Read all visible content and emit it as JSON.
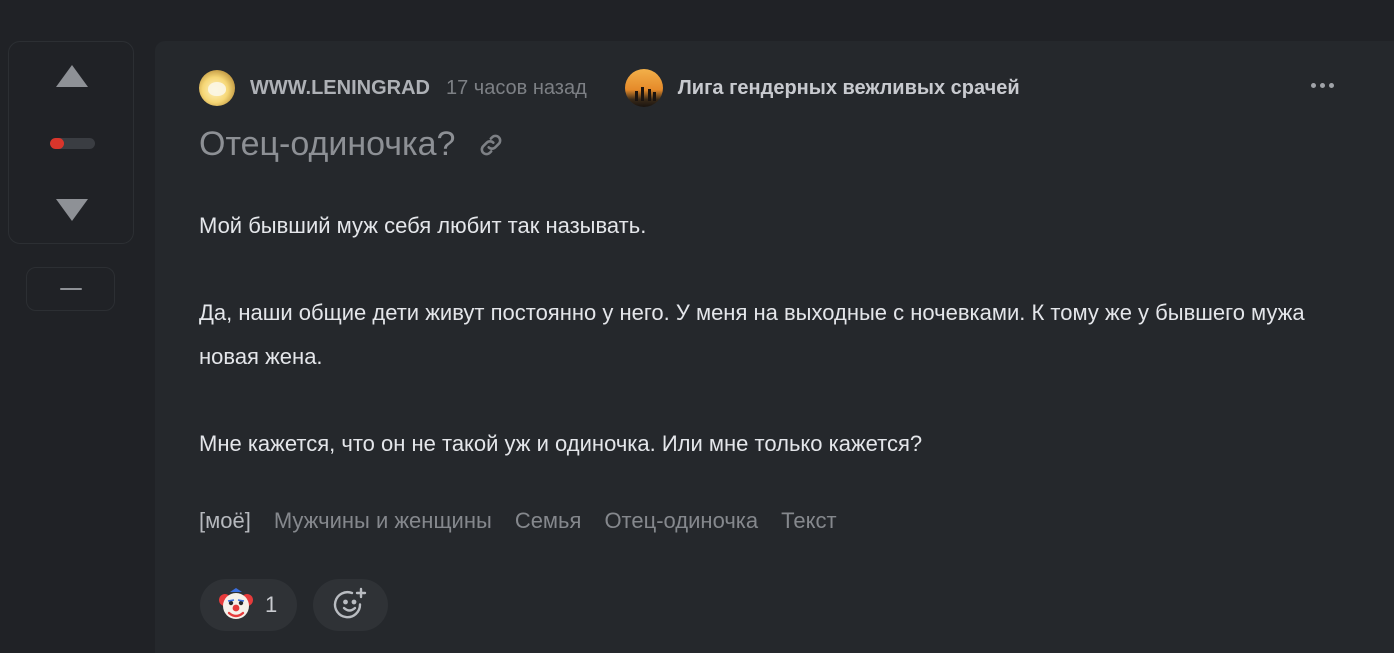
{
  "post": {
    "author": "WWW.LENINGRAD",
    "time": "17 часов назад",
    "community": "Лига гендерных вежливых срачей",
    "title": "Отец-одиночка?",
    "paragraphs": [
      "Мой бывший муж себя любит так называть.",
      "Да, наши общие дети живут постоянно у него. У меня на выходные с ночевками. К тому же у бывшего мужа новая жена.",
      "Мне кажется, что он не такой уж и одиночка. Или мне только кажется?"
    ],
    "tags": [
      "[моё]",
      "Мужчины и женщины",
      "Семья",
      "Отец-одиночка",
      "Текст"
    ],
    "rating_fraction": 0.3
  },
  "reactions": {
    "clown_icon": "clown-face-icon",
    "clown_count": "1",
    "add_icon": "add-reaction-smile-icon"
  },
  "icons": {
    "vote_up": "triangle-up-icon",
    "vote_down": "triangle-down-icon",
    "link": "link-icon",
    "more": "more-dots-icon",
    "hide": "minus-icon"
  },
  "colors": {
    "background": "#202226",
    "card": "#25282c",
    "rating_negative": "#d9352b"
  }
}
